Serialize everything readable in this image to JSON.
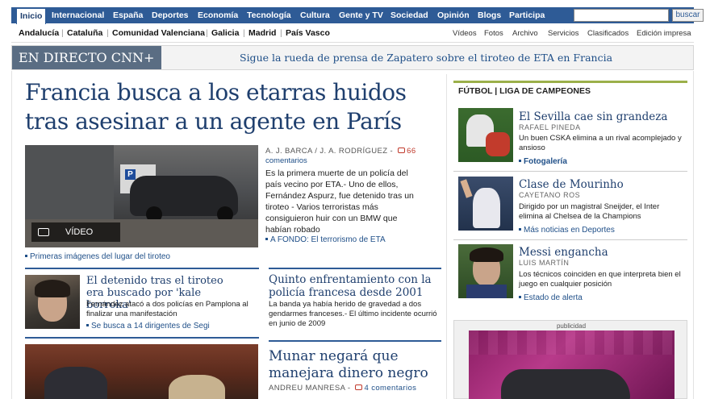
{
  "topnav": {
    "tabs": [
      "Inicio",
      "Internacional",
      "España",
      "Deportes",
      "Economía",
      "Tecnología",
      "Cultura",
      "Gente y TV",
      "Sociedad",
      "Opinión",
      "Blogs",
      "Participa"
    ],
    "search_placeholder": "",
    "search_button": "buscar"
  },
  "subnav": {
    "regions": [
      "Andalucía",
      "Cataluña",
      "Comunidad Valenciana",
      "Galicia",
      "Madrid",
      "País Vasco"
    ],
    "links": [
      "Vídeos",
      "Fotos",
      "Archivo",
      "Servicios",
      "Clasificados",
      "Edición impresa"
    ]
  },
  "livebar": {
    "label": "EN DIRECTO CNN+",
    "text": "Sigue la rueda de prensa de Zapatero sobre el tiroteo de ETA en Francia"
  },
  "lead": {
    "headline": "Francia busca a los etarras huidos tras asesinar a un agente en París",
    "video_badge": "VÍDEO",
    "video_caption": "Primeras imágenes del lugar del tiroteo",
    "byline": "A. J. BARCA / J. A. RODRÍGUEZ -",
    "comments_count": "66",
    "comments_label": "comentarios",
    "summary": "Es la primera muerte de un policía del país vecino por ETA.- Uno de ellos, Fernández Aspurz, fue detenido tras un tiroteo - Varios terroristas más consiguieron huir con un BMW que habían robado",
    "related_link": "A FONDO: El terrorismo de ETA"
  },
  "story1": {
    "title": "El detenido tras el tiroteo era buscado por 'kale borroka'",
    "body": "Fernández atacó a dos policías en Pamplona al finalizar una manifestación",
    "link": "Se busca a 14 dirigentes de Segi"
  },
  "story2": {
    "title": "Quinto enfrentamiento con la policía francesa desde 2001",
    "body": "La banda ya había herido de gravedad a dos gendarmes franceses.- El último incidente ocurrió en junio de 2009"
  },
  "story3": {
    "title": "Munar negará que manejara dinero negro",
    "byline": "ANDREU MANRESA -",
    "comments": "4 comentarios"
  },
  "sports": {
    "header": "FÚTBOL | LIGA DE CAMPEONES",
    "items": [
      {
        "title": "El Sevilla cae sin grandeza",
        "author": "RAFAEL PINEDA",
        "body": "Un buen CSKA elimina a un rival acomplejado y ansioso",
        "link": "Fotogalería"
      },
      {
        "title": "Clase de Mourinho",
        "author": "CAYETANO ROS",
        "body": "Dirigido por un magistral Sneijder, el Inter elimina al Chelsea de la Champions",
        "link": "Más noticias en Deportes"
      },
      {
        "title": "Messi engancha",
        "author": "LUIS MARTÍN",
        "body": "Los técnicos coinciden en que interpreta bien el juego en cualquier posición",
        "link": "Estado de alerta"
      }
    ]
  },
  "ad": {
    "label": "publicidad"
  },
  "colors": {
    "nav_blue": "#2e5b96",
    "link_blue": "#1f4f88",
    "headline_blue": "#1f3f6e",
    "sports_green": "#9bb04a",
    "comment_red": "#c0392b"
  }
}
